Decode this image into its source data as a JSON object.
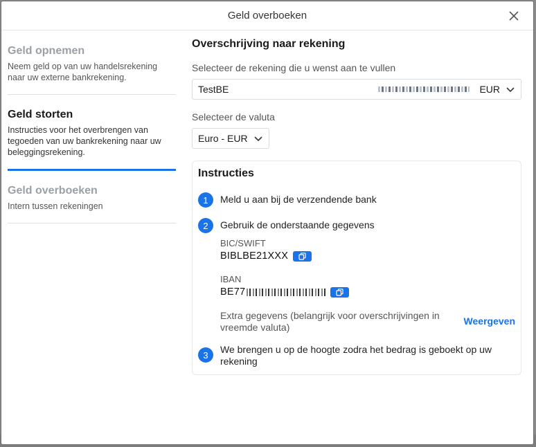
{
  "modal": {
    "title": "Geld overboeken"
  },
  "sidebar": {
    "items": [
      {
        "title": "Geld opnemen",
        "desc": "Neem geld op van uw handelsrekening naar uw externe bankrekening."
      },
      {
        "title": "Geld storten",
        "desc": "Instructies voor het overbrengen van tegoeden van uw bankrekening naar uw beleggingsrekening."
      },
      {
        "title": "Geld overboeken",
        "desc": "Intern tussen rekeningen"
      }
    ]
  },
  "main": {
    "title": "Overschrijving naar rekening",
    "account_label": "Selecteer de rekening die u wenst aan te vullen",
    "account_name": "TestBE",
    "account_currency": "EUR",
    "currency_label": "Selecteer de valuta",
    "currency_value": "Euro - EUR"
  },
  "instructions": {
    "title": "Instructies",
    "steps": [
      {
        "num": "1",
        "text": "Meld u aan bij de verzendende bank"
      },
      {
        "num": "2",
        "text": "Gebruik de onderstaande gegevens"
      },
      {
        "num": "3",
        "text": "We brengen u op de hoogte zodra het bedrag is geboekt op uw rekening"
      }
    ],
    "bic_label": "BIC/SWIFT",
    "bic_value": "BIBLBE21XXX",
    "iban_label": "IBAN",
    "iban_prefix": "BE77",
    "extra_text": "Extra gegevens (belangrijk voor overschrijvingen in vreemde valuta)",
    "show_link": "Weergeven"
  },
  "colors": {
    "accent": "#1a73e8"
  }
}
